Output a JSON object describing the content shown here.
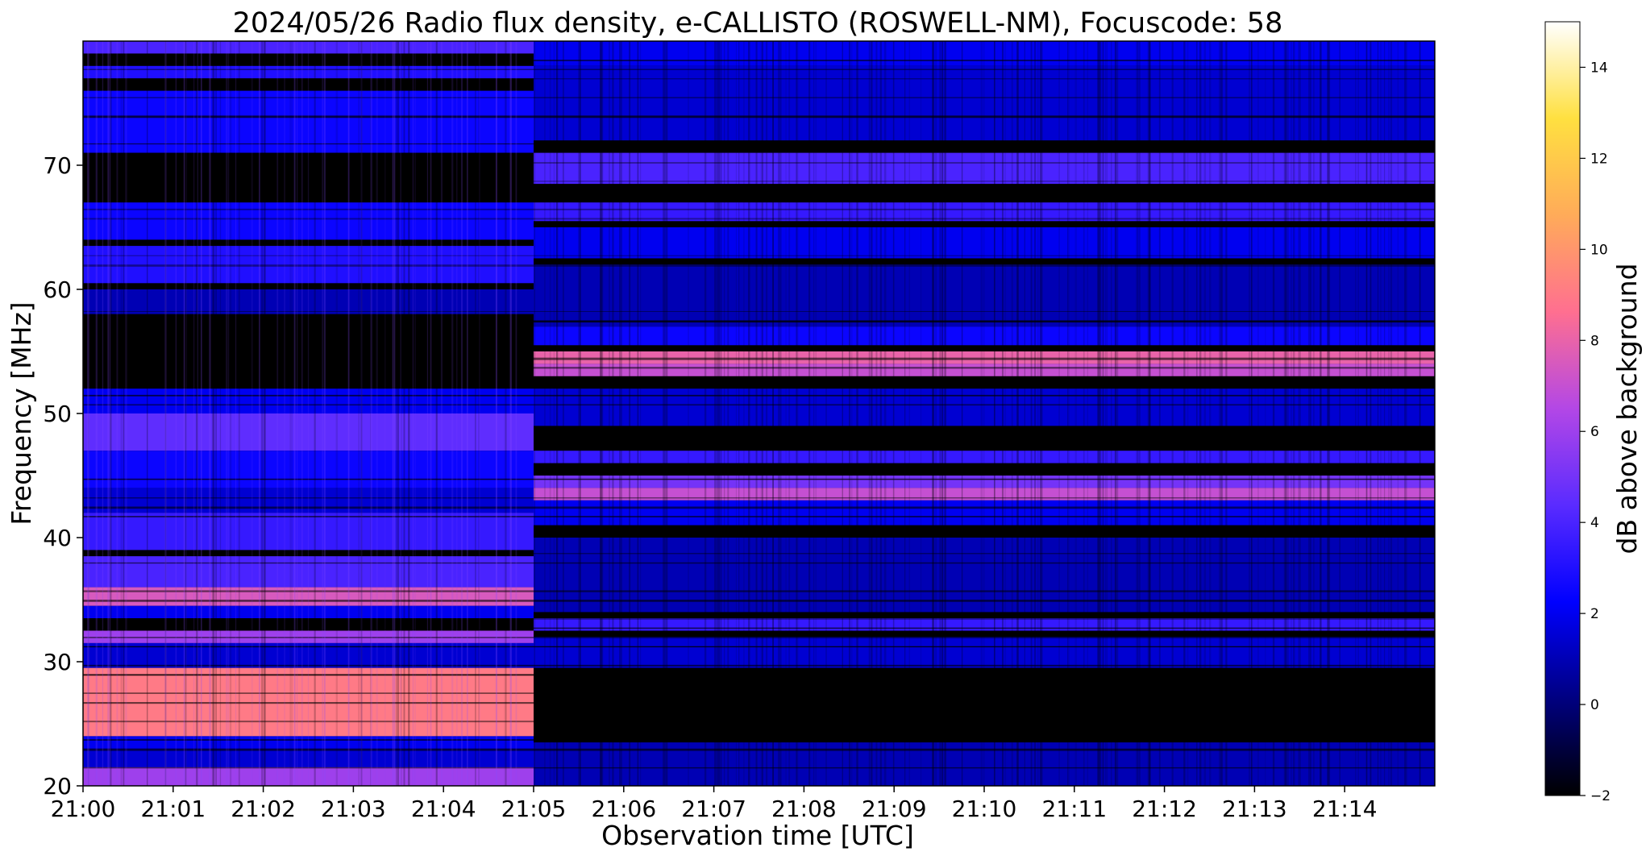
{
  "chart_data": {
    "type": "heatmap",
    "title": "2024/05/26  Radio flux density, e-CALLISTO (ROSWELL-NM), Focuscode: 58",
    "xlabel": "Observation time [UTC]",
    "ylabel": "Frequency [MHz]",
    "colorbar_label": "dB above background",
    "colormap": "gnuplot2",
    "colormap_stops": [
      "#000000",
      "#000080",
      "#0000ff",
      "#5a2bff",
      "#b347e6",
      "#ff6f90",
      "#ffab59",
      "#ffe040",
      "#ffffff"
    ],
    "x_range": [
      "21:00",
      "21:15"
    ],
    "ylim": [
      20,
      80
    ],
    "clim": [
      -2,
      15
    ],
    "x_ticks": [
      "21:00",
      "21:01",
      "21:02",
      "21:03",
      "21:04",
      "21:05",
      "21:06",
      "21:07",
      "21:08",
      "21:09",
      "21:10",
      "21:11",
      "21:12",
      "21:13",
      "21:14"
    ],
    "y_ticks": [
      20,
      30,
      40,
      50,
      60,
      70
    ],
    "colorbar_ticks": [
      -2,
      0,
      2,
      4,
      6,
      8,
      10,
      12,
      14
    ],
    "segment_break": "21:05",
    "bands_before_break": [
      {
        "freq": [
          79,
          80
        ],
        "db": 4
      },
      {
        "freq": [
          77,
          78
        ],
        "db": 3
      },
      {
        "freq": [
          71,
          76
        ],
        "db": 2.5
      },
      {
        "freq": [
          68,
          71
        ],
        "db": -2
      },
      {
        "freq": [
          64,
          67
        ],
        "db": 2.5
      },
      {
        "freq": [
          60.5,
          63.5
        ],
        "db": 3
      },
      {
        "freq": [
          58,
          60
        ],
        "db": 1
      },
      {
        "freq": [
          52,
          58
        ],
        "db": -2
      },
      {
        "freq": [
          50,
          52
        ],
        "db": 2
      },
      {
        "freq": [
          47,
          50
        ],
        "db": 4.5
      },
      {
        "freq": [
          44,
          47
        ],
        "db": 2.5
      },
      {
        "freq": [
          42,
          44
        ],
        "db": 1.5
      },
      {
        "freq": [
          39,
          42
        ],
        "db": 3.5
      },
      {
        "freq": [
          36,
          38.5
        ],
        "db": 4
      },
      {
        "freq": [
          34.5,
          36
        ],
        "db": 7.5
      },
      {
        "freq": [
          33.5,
          34.5
        ],
        "db": 2
      },
      {
        "freq": [
          32.5,
          33.5
        ],
        "db": -2
      },
      {
        "freq": [
          31.5,
          32.5
        ],
        "db": 6
      },
      {
        "freq": [
          29.5,
          31.5
        ],
        "db": 1.5
      },
      {
        "freq": [
          24,
          29.5
        ],
        "db": 9
      },
      {
        "freq": [
          23,
          24
        ],
        "db": 2
      },
      {
        "freq": [
          21.5,
          23
        ],
        "db": 1.5
      },
      {
        "freq": [
          20,
          21.5
        ],
        "db": 6
      }
    ],
    "bands_after_break": [
      {
        "freq": [
          78,
          80
        ],
        "db": 2
      },
      {
        "freq": [
          72,
          78
        ],
        "db": 1.5
      },
      {
        "freq": [
          68.5,
          71
        ],
        "db": 4
      },
      {
        "freq": [
          65.5,
          67
        ],
        "db": 3.5
      },
      {
        "freq": [
          62.5,
          65
        ],
        "db": 2
      },
      {
        "freq": [
          57,
          62
        ],
        "db": 1
      },
      {
        "freq": [
          55.5,
          57
        ],
        "db": 2.5
      },
      {
        "freq": [
          54,
          55
        ],
        "db": 8
      },
      {
        "freq": [
          53,
          54
        ],
        "db": 7
      },
      {
        "freq": [
          49,
          52
        ],
        "db": 1.5
      },
      {
        "freq": [
          46,
          47
        ],
        "db": 3.5
      },
      {
        "freq": [
          44,
          45
        ],
        "db": 5
      },
      {
        "freq": [
          43,
          44
        ],
        "db": 7
      },
      {
        "freq": [
          41,
          43
        ],
        "db": 2
      },
      {
        "freq": [
          34,
          40
        ],
        "db": 1
      },
      {
        "freq": [
          32.5,
          33.5
        ],
        "db": 3.5
      },
      {
        "freq": [
          29.5,
          32
        ],
        "db": 1.5
      },
      {
        "freq": [
          23.5,
          29.5
        ],
        "db": -2
      },
      {
        "freq": [
          20,
          23.5
        ],
        "db": 1
      }
    ]
  }
}
